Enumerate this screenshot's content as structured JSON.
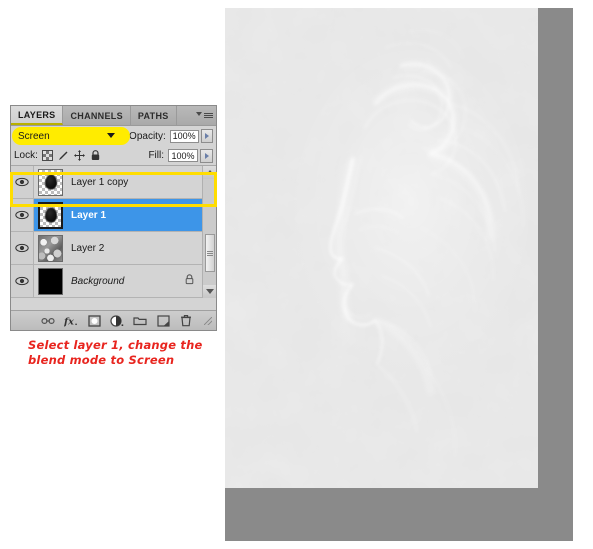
{
  "panel": {
    "tabs": [
      {
        "label": "LAYERS",
        "active": true
      },
      {
        "label": "CHANNELS",
        "active": false
      },
      {
        "label": "PATHS",
        "active": false
      }
    ],
    "menu_icon": "panel-menu-icon",
    "blend_mode": {
      "value": "Screen",
      "highlighted": true,
      "highlight_color": "#ffec00"
    },
    "opacity": {
      "label": "Opacity:",
      "value": "100%"
    },
    "fill": {
      "label": "Fill:",
      "value": "100%"
    },
    "lock": {
      "label": "Lock:",
      "icons": [
        "lock-transparency-icon",
        "lock-image-icon",
        "lock-position-icon",
        "lock-all-icon"
      ]
    },
    "layers": [
      {
        "name": "Layer 1 copy",
        "visible": true,
        "selected": false,
        "locked": false,
        "italic": false,
        "thumb": "blob-on-transparency"
      },
      {
        "name": "Layer 1",
        "visible": true,
        "selected": true,
        "locked": false,
        "italic": false,
        "thumb": "blob-on-transparency"
      },
      {
        "name": "Layer 2",
        "visible": true,
        "selected": false,
        "locked": false,
        "italic": false,
        "thumb": "noise-clouds"
      },
      {
        "name": "Background",
        "visible": true,
        "selected": false,
        "locked": true,
        "italic": true,
        "thumb": "solid-black"
      }
    ],
    "selection_outline_color": "#ffdd00",
    "selected_row_color": "#3d95e8",
    "toolbar_icons": [
      "link-layers-icon",
      "layer-style-fx-icon",
      "layer-mask-icon",
      "adjustment-layer-icon",
      "new-group-icon",
      "new-layer-icon",
      "delete-layer-icon"
    ],
    "scrollbar": {
      "up": "scroll-up-arrow",
      "down": "scroll-down-arrow"
    }
  },
  "caption": {
    "line1": "Select layer 1, change the",
    "line2": "blend mode to Screen",
    "color": "#e8251f"
  },
  "artwork": {
    "description": "grayscale smoke face profile over cloud texture"
  }
}
